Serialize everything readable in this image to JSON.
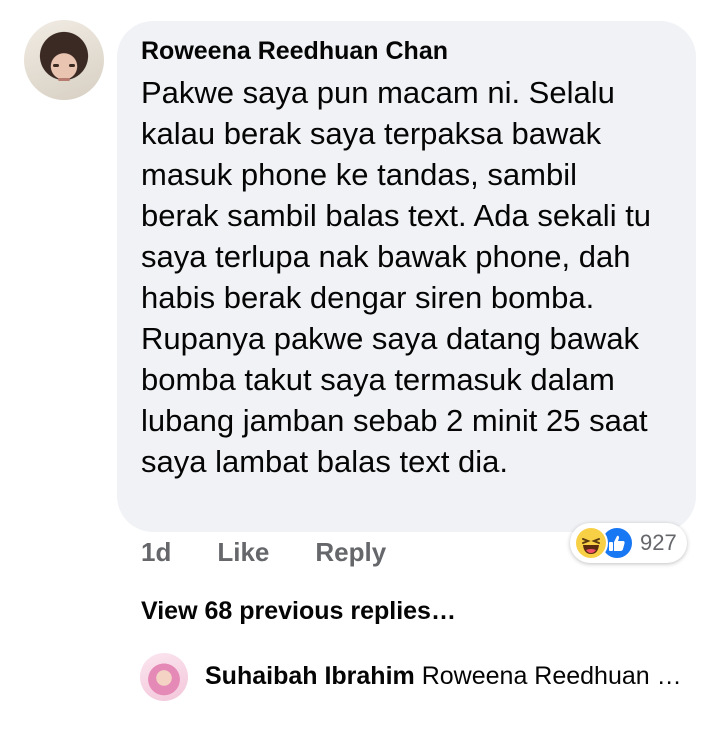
{
  "comment": {
    "author": "Roweena Reedhuan Chan",
    "text": "Pakwe saya pun macam ni. Selalu\nkalau berak saya terpaksa bawak\nmasuk phone ke tandas, sambil\nberak sambil balas text. Ada sekali tu\nsaya terlupa nak bawak phone, dah\nhabis berak dengar siren bomba.\nRupanya pakwe saya datang bawak\nbomba takut saya termasuk dalam\nlubang jamban sebab 2 minit 25 saat\nsaya lambat balas text dia.",
    "time": "1d",
    "like_label": "Like",
    "reply_label": "Reply",
    "reaction_count": "927",
    "reaction_icons": [
      "haha-emoji-icon",
      "like-thumb-icon"
    ]
  },
  "replies": {
    "view_previous_label": "View 68 previous replies…",
    "preview": {
      "author": "Suhaibah Ibrahim",
      "text": "Roweena Reedhuan …"
    }
  },
  "colors": {
    "bubble_bg": "#f0f2f5",
    "secondary_text": "#65676b",
    "like_blue": "#1877f2",
    "haha_yellow": "#f7d046"
  }
}
